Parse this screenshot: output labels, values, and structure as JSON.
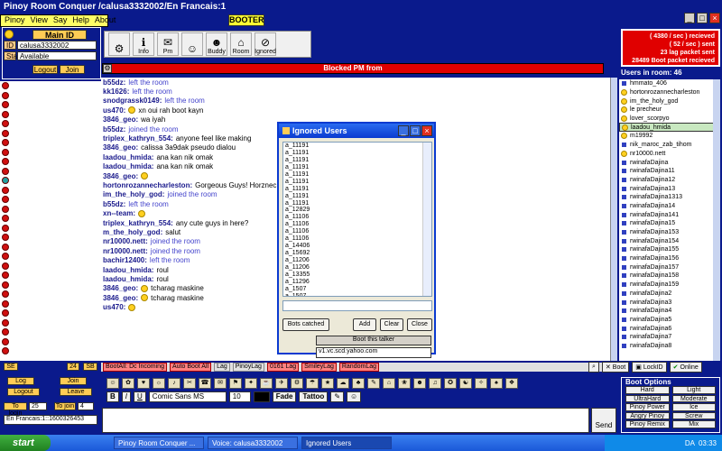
{
  "window": {
    "title": "Pinoy Room Conquer /calusa3332002/En Francais:1"
  },
  "menu": [
    "Pinoy",
    "View",
    "Say",
    "Help",
    "About"
  ],
  "booter_label": "BOOTER",
  "login": {
    "main_id_label": "Main ID",
    "id_label": "ID",
    "id_value": "calusa3332002",
    "stat_label": "Stat",
    "stat_value": "Available",
    "logout": "Logout",
    "join": "Join"
  },
  "toolbar": [
    {
      "label": ""
    },
    {
      "label": "Info"
    },
    {
      "label": "Pm"
    },
    {
      "label": ""
    },
    {
      "label": "Buddy"
    },
    {
      "label": "Room"
    },
    {
      "label": "Ignored"
    }
  ],
  "stats": [
    "( 4380 / sec ) recieved",
    "( 52 / sec ) sent",
    "23 lag packet sent",
    "28489 Boot packet recieved"
  ],
  "pm_bar": "Blocked PM from",
  "users_header": "Users in room: 46",
  "chat": [
    {
      "nick": "b55dz:",
      "text": "left the room",
      "sys": true
    },
    {
      "nick": "kk1626:",
      "text": "left the room",
      "sys": true
    },
    {
      "nick": "snodgrassk0149:",
      "text": "left the room",
      "sys": true
    },
    {
      "nick": "us470:",
      "text": "xn oui rah boot kayn",
      "emoji": true
    },
    {
      "nick": "3846_geo:",
      "text": "wa iyah"
    },
    {
      "nick": "b55dz:",
      "text": "joined the room",
      "sys": true
    },
    {
      "nick": "triplex_kathryn_554:",
      "text": "anyone feel like making"
    },
    {
      "nick": "3846_geo:",
      "text": "calissa 3a9dak pseudo dialou"
    },
    {
      "nick": "laadou_hmida:",
      "text": "ana kan nik omak"
    },
    {
      "nick": "laadou_hmida:",
      "text": "ana kan nik omak"
    },
    {
      "nick": "3846_geo:",
      "text": "",
      "emoji": true
    },
    {
      "nick": "hortonrozannecharleston:",
      "text": "Gorgeous Guys! Horznec"
    },
    {
      "nick": "im_the_holy_god:",
      "text": "joined the room",
      "sys": true
    },
    {
      "nick": "b55dz:",
      "text": "left the room",
      "sys": true
    },
    {
      "nick": "xn--team:",
      "text": "",
      "emoji": true
    },
    {
      "nick": "triplex_kathryn_554:",
      "text": "any cute guys in here?"
    },
    {
      "nick": "m_the_holy_god:",
      "text": "salut"
    },
    {
      "nick": "nr10000.nett:",
      "text": "joined the room",
      "sys": true
    },
    {
      "nick": "nr10000.nett:",
      "text": "joined the room",
      "sys": true
    },
    {
      "nick": "bachir12400:",
      "text": "left the room",
      "sys": true
    },
    {
      "nick": "laadou_hmida:",
      "text": "roul"
    },
    {
      "nick": "laadou_hmida:",
      "text": "roul"
    },
    {
      "nick": "3846_geo:",
      "text": "tcharag maskine",
      "emoji": true
    },
    {
      "nick": "3846_geo:",
      "text": "tcharag maskine",
      "emoji": true
    },
    {
      "nick": "us470:",
      "text": "",
      "emoji": true
    }
  ],
  "users": [
    {
      "name": "hmmato_406",
      "icon": "p"
    },
    {
      "name": "hortonrozannecharleston",
      "icon": "s"
    },
    {
      "name": "im_the_holy_god",
      "icon": "s"
    },
    {
      "name": "le precheur",
      "icon": "s"
    },
    {
      "name": "lover_scorpyo",
      "icon": "s"
    },
    {
      "name": "laadou_hmida",
      "icon": "s",
      "selected": true
    },
    {
      "name": "m19992",
      "icon": "s"
    },
    {
      "name": "nik_maroc_zab_tihom",
      "icon": "p"
    },
    {
      "name": "nr10000.nett",
      "icon": "s"
    },
    {
      "name": "rwinafaDajina",
      "icon": "p"
    },
    {
      "name": "rwinafaDajina11",
      "icon": "p"
    },
    {
      "name": "rwinafaDajina12",
      "icon": "p"
    },
    {
      "name": "rwinafaDajina13",
      "icon": "p"
    },
    {
      "name": "rwinafaDajina1313",
      "icon": "p"
    },
    {
      "name": "rwinafaDajina14",
      "icon": "p"
    },
    {
      "name": "rwinafaDajina141",
      "icon": "p"
    },
    {
      "name": "rwinafaDajina15",
      "icon": "p"
    },
    {
      "name": "rwinafaDajina153",
      "icon": "p"
    },
    {
      "name": "rwinafaDajina154",
      "icon": "p"
    },
    {
      "name": "rwinafaDajina155",
      "icon": "p"
    },
    {
      "name": "rwinafaDajina156",
      "icon": "p"
    },
    {
      "name": "rwinafaDajina157",
      "icon": "p"
    },
    {
      "name": "rwinafaDajina158",
      "icon": "p"
    },
    {
      "name": "rwinafaDajina159",
      "icon": "p"
    },
    {
      "name": "rwinafaDajina2",
      "icon": "p"
    },
    {
      "name": "rwinafaDajina3",
      "icon": "p"
    },
    {
      "name": "rwinafaDajina4",
      "icon": "p"
    },
    {
      "name": "rwinafaDajina5",
      "icon": "p"
    },
    {
      "name": "rwinafaDajina6",
      "icon": "p"
    },
    {
      "name": "rwinafaDajina7",
      "icon": "p"
    },
    {
      "name": "rwinafaDajina8",
      "icon": "p"
    }
  ],
  "dialog": {
    "title": "Ignored Users",
    "items": [
      "a_11191",
      "a_11191",
      "a_11191",
      "a_11191",
      "a_11191",
      "a_11191",
      "a_11191",
      "a_11191",
      "a_11191",
      "a_12829",
      "a_11106",
      "a_11106",
      "a_11106",
      "a_11106",
      "a_14406",
      "a_15692",
      "a_11206",
      "a_11206",
      "a_13355",
      "a_11296",
      "a_1507",
      "a_1507"
    ],
    "bots_caught": "Bots catched",
    "add": "Add",
    "clear": "Clear",
    "close": "Close"
  },
  "boot_talker": "Boot this talker",
  "yahoo_server": "v1.vc.scd.yahoo.com",
  "tabs": [
    "BootAll: Dc Incoming",
    "Auto Boot All",
    "Lag",
    "PinoyLag",
    "0161 Lag",
    "SmileyLag",
    "RandomLag"
  ],
  "right_buttons": {
    "boot": "Boot",
    "lockid": "LockID",
    "online": "Online"
  },
  "format": {
    "bold": "B",
    "italic": "I",
    "underline": "U",
    "font": "Comic Sans MS",
    "size": "10",
    "fade": "Fade",
    "tattoo": "Tattoo"
  },
  "send": "Send",
  "boot_options": {
    "title": "Boot Options",
    "items": [
      "Hard",
      "Light",
      "UltraHard",
      "Moderate",
      "Pinoy Power",
      "Ice",
      "Angry Pinoy",
      "Screw",
      "Pinoy Remix",
      "Mix"
    ]
  },
  "left_bottom": {
    "se": "SE",
    "n24": "24",
    "sb": "SB",
    "log": "Log",
    "join": "Join",
    "logout": "Logout",
    "leave": "Leave",
    "to_login": "To login",
    "to_login_val": "25",
    "to_join": "To join",
    "to_join_val": "4",
    "room": "En Francais:1::1600326453"
  },
  "taskbar": {
    "start": "start",
    "tasks": [
      "Pinoy Room Conquer ...",
      "Voice: calusa3332002",
      "Ignored Users"
    ],
    "lang": "DA",
    "time": "03:33"
  }
}
